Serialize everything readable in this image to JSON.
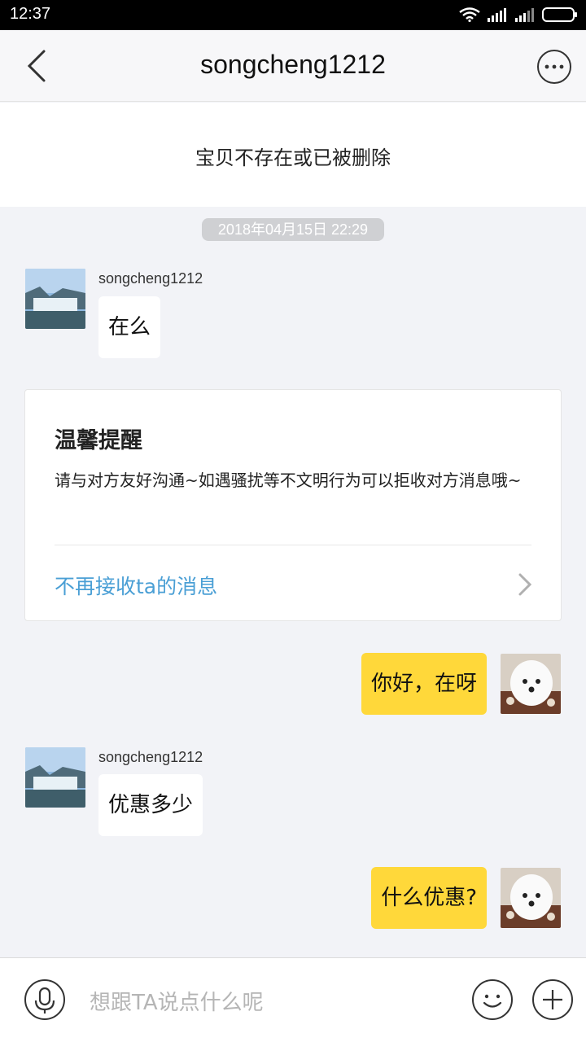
{
  "status_bar": {
    "time": "12:37"
  },
  "nav": {
    "title": "songcheng1212"
  },
  "item_banner": {
    "text": "宝贝不存在或已被删除"
  },
  "timestamp": "2018年04月15日 22:29",
  "messages": [
    {
      "direction": "in",
      "sender": "songcheng1212",
      "text": "在么"
    },
    {
      "direction": "out",
      "text": "你好，在呀"
    },
    {
      "direction": "in",
      "sender": "songcheng1212",
      "text": "优惠多少"
    },
    {
      "direction": "out",
      "text": "什么优惠?"
    }
  ],
  "notice": {
    "title": "温馨提醒",
    "body": "请与对方友好沟通~如遇骚扰等不文明行为可以拒收对方消息哦~",
    "link": "不再接收ta的消息"
  },
  "input": {
    "placeholder": "想跟TA说点什么呢"
  },
  "colors": {
    "accent_link": "#4a9fd5",
    "outgoing_bubble": "#ffd83a",
    "background": "#f2f3f7"
  },
  "icons": [
    "wifi-icon",
    "signal-icon",
    "battery-icon",
    "back-icon",
    "more-icon",
    "chevron-right-icon",
    "microphone-icon",
    "emoji-icon",
    "plus-icon"
  ]
}
